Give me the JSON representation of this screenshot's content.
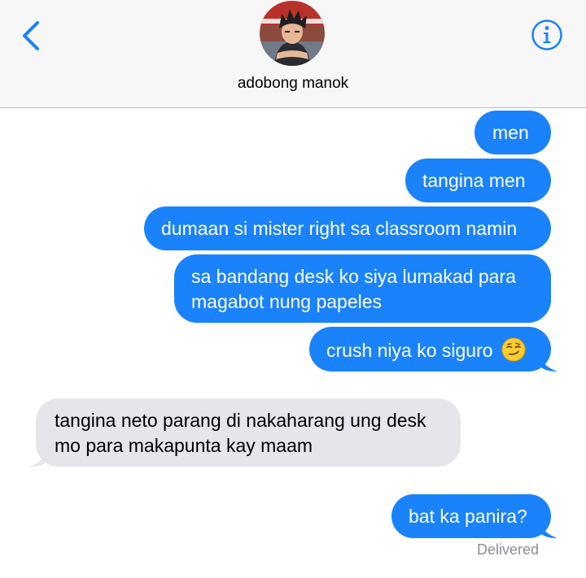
{
  "header": {
    "contact_name": "adobong manok",
    "back_icon": "chevron-left-icon",
    "info_icon": "info-icon"
  },
  "messages": [
    {
      "sender": "me",
      "text": "men"
    },
    {
      "sender": "me",
      "text": "tangina men"
    },
    {
      "sender": "me",
      "text": "dumaan si mister right sa classroom namin"
    },
    {
      "sender": "me",
      "lines": [
        "sa bandang desk ko siya lumakad para",
        "magabot nung papeles"
      ]
    },
    {
      "sender": "me",
      "text": "crush niya ko siguro",
      "emoji": "smirking-face"
    },
    {
      "sender": "them",
      "lines": [
        "tangina neto parang di nakaharang ung desk",
        "mo para makapunta kay maam"
      ]
    },
    {
      "sender": "me",
      "text": "bat ka panira?"
    }
  ],
  "status": {
    "delivered": "Delivered"
  },
  "colors": {
    "outgoing": "#1a82fb",
    "incoming": "#e6e5eb",
    "accent": "#1a82fb"
  }
}
